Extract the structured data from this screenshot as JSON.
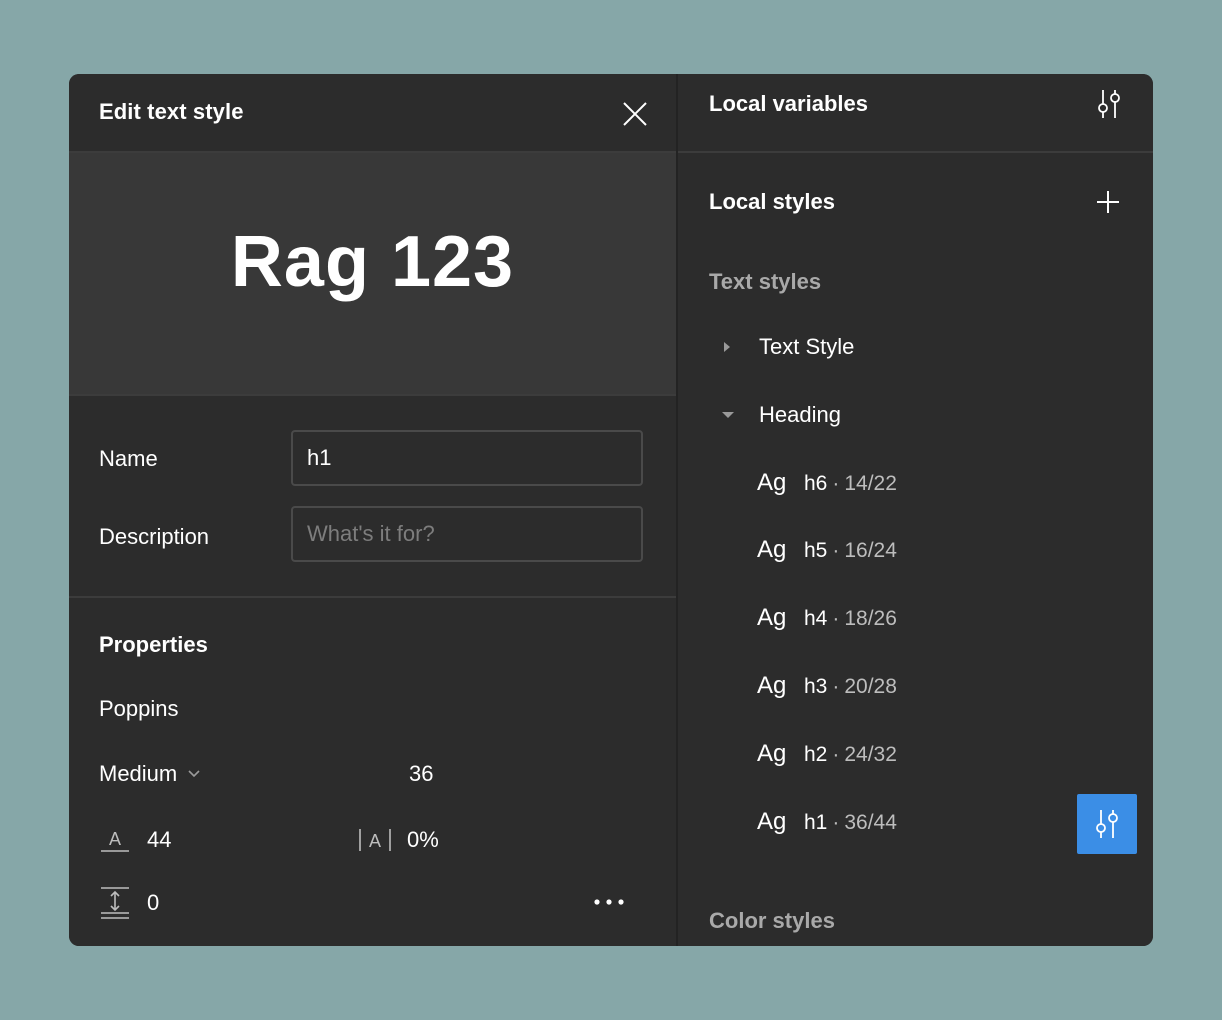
{
  "edit_panel": {
    "title": "Edit text style",
    "preview_text": "Rag 123",
    "name_label": "Name",
    "name_value": "h1",
    "description_label": "Description",
    "description_placeholder": "What's it for?",
    "properties_title": "Properties",
    "font_family": "Poppins",
    "font_weight": "Medium",
    "font_size": "36",
    "line_height": "44",
    "letter_spacing": "0%",
    "paragraph_spacing": "0"
  },
  "right_panel": {
    "local_variables_title": "Local variables",
    "local_styles_title": "Local styles",
    "text_styles_heading": "Text styles",
    "groups": [
      {
        "label": "Text Style",
        "expanded": false
      },
      {
        "label": "Heading",
        "expanded": true
      }
    ],
    "styles": [
      {
        "ag": "Ag",
        "name": "h6",
        "dot": "·",
        "size": "14/22"
      },
      {
        "ag": "Ag",
        "name": "h5",
        "dot": "·",
        "size": "16/24"
      },
      {
        "ag": "Ag",
        "name": "h4",
        "dot": "·",
        "size": "18/26"
      },
      {
        "ag": "Ag",
        "name": "h3",
        "dot": "·",
        "size": "20/28"
      },
      {
        "ag": "Ag",
        "name": "h2",
        "dot": "·",
        "size": "24/32"
      },
      {
        "ag": "Ag",
        "name": "h1",
        "dot": "·",
        "size": "36/44"
      }
    ],
    "color_styles_heading": "Color styles"
  },
  "colors": {
    "background": "#86a7a8",
    "panel": "#2c2c2c",
    "preview": "#383838",
    "accent": "#3b8ee6",
    "muted_text": "#a9a9a9"
  }
}
